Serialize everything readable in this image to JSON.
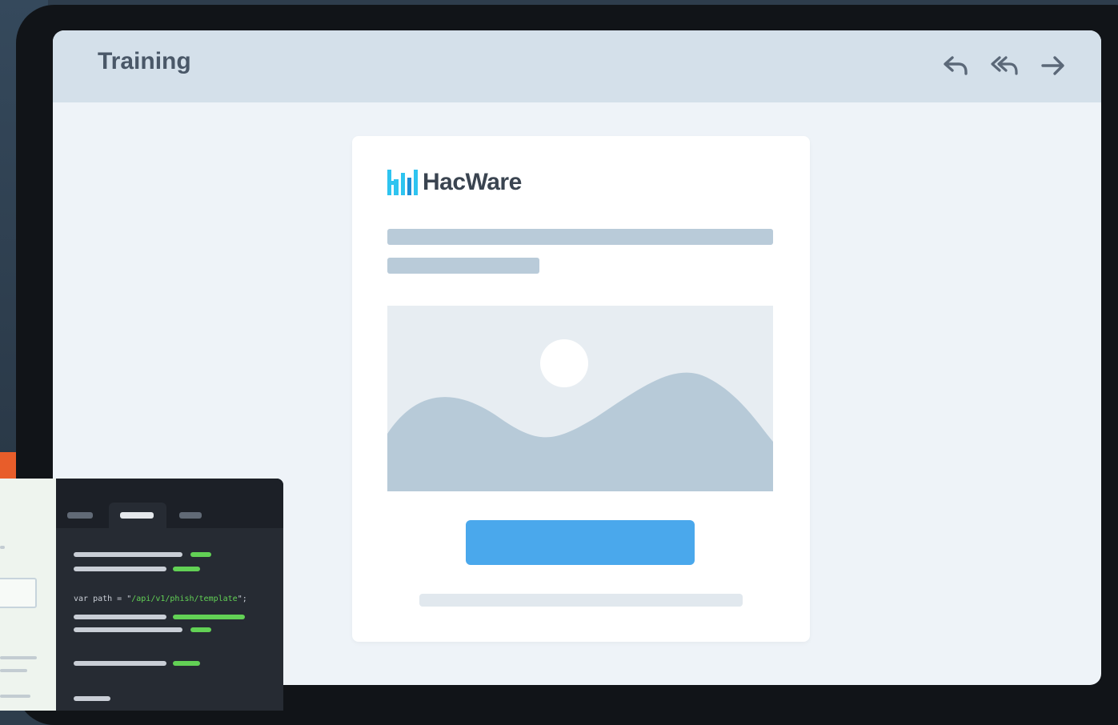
{
  "app": {
    "window_title": "Training",
    "logo_text": "HacWare"
  },
  "header": {
    "icons": [
      {
        "name": "reply-icon",
        "label": "Reply"
      },
      {
        "name": "reply-all-icon",
        "label": "Reply all"
      },
      {
        "name": "forward-icon",
        "label": "Forward"
      }
    ]
  },
  "code_editor": {
    "code_line": {
      "prefix": "var path = \"",
      "string": "/api/v1/phish/template",
      "suffix": "\";"
    }
  },
  "colors": {
    "accent": "#4aa8ec",
    "logo_cyan": "#2ec4f0",
    "code_green": "#62d155",
    "header_bg": "#d4e0ea"
  }
}
